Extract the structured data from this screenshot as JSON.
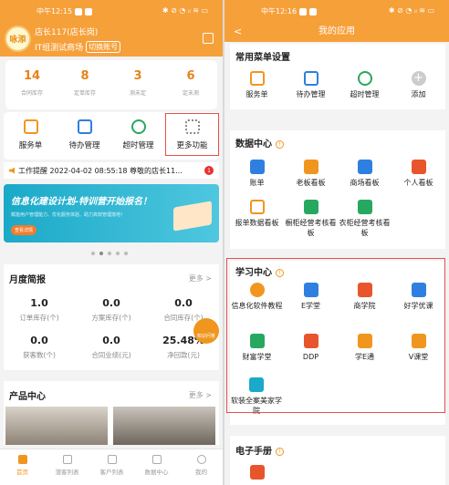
{
  "colors": {
    "accent": "#f6a03a",
    "highlight": "#e35050"
  },
  "left": {
    "status_time": "中午12:15",
    "status_right": "✱ ⊘ ◔ ᵢₗ ≋ ▭",
    "logo_text": "咏添",
    "user_name": "店长117(店长岗)",
    "store_name": "IT组测试商场",
    "switch_label": "切换账号",
    "stats": [
      {
        "value": "14",
        "label": "合同库存"
      },
      {
        "value": "8",
        "label": "定单库存"
      },
      {
        "value": "3",
        "label": "测未定"
      },
      {
        "value": "6",
        "label": "定未测"
      }
    ],
    "quick": [
      {
        "label": "服务单",
        "icon": "clipboard-icon"
      },
      {
        "label": "待办管理",
        "icon": "todo-icon"
      },
      {
        "label": "超时管理",
        "icon": "alarm-clock-icon"
      },
      {
        "label": "更多功能",
        "icon": "more-grid-icon"
      }
    ],
    "notice": "工作提醒 2022-04-02 08:55:18 尊敬的店长11...",
    "notice_badge": "1",
    "banner_title": "信息化建设计划-特训营开始报名！",
    "banner_sub": "赋能用户管理能力、优化服务体验、助力高效管理落地！",
    "banner_btn": "查看详情",
    "monthly_title": "月度简报",
    "more": "更多 >",
    "monthly": [
      {
        "value": "1.0",
        "label": "订单库存(个)"
      },
      {
        "value": "0.0",
        "label": "方案库存(个)"
      },
      {
        "value": "0.0",
        "label": "合同库存(个)"
      },
      {
        "value": "0.0",
        "label": "获客数(个)"
      },
      {
        "value": "0.0",
        "label": "合同业绩(元)"
      },
      {
        "value": "25.48%",
        "label": "净回款(元)"
      }
    ],
    "fab_label": "知识问答",
    "product_title": "产品中心",
    "product_more": "更多 >",
    "tabs": [
      {
        "label": "首页",
        "icon": "home-icon"
      },
      {
        "label": "潜客列表",
        "icon": "list-icon"
      },
      {
        "label": "客户列表",
        "icon": "customers-icon"
      },
      {
        "label": "数据中心",
        "icon": "chart-icon"
      },
      {
        "label": "我的",
        "icon": "profile-icon"
      }
    ]
  },
  "right": {
    "status_time": "中午12:16",
    "status_right": "✱ ⊘ ◔ ᵢₗ ≋ ▭",
    "title": "我的应用",
    "back": "<",
    "common_title": "常用菜单设置",
    "common": [
      {
        "label": "服务单",
        "icon": "clipboard-icon"
      },
      {
        "label": "待办管理",
        "icon": "todo-icon"
      },
      {
        "label": "超时管理",
        "icon": "alarm-clock-icon"
      },
      {
        "label": "添加",
        "icon": "add-icon"
      }
    ],
    "data_title": "数据中心",
    "data_items": [
      {
        "label": "账单",
        "icon": "bill-icon"
      },
      {
        "label": "老板看板",
        "icon": "boss-board-icon"
      },
      {
        "label": "商场看板",
        "icon": "mall-board-icon"
      },
      {
        "label": "个人看板",
        "icon": "personal-board-icon"
      },
      {
        "label": "报单数据看板",
        "icon": "report-board-icon"
      },
      {
        "label": "橱柜经营考核看板",
        "icon": "cabinet-board-icon"
      },
      {
        "label": "衣柜经营考核看板",
        "icon": "wardrobe-board-icon"
      }
    ],
    "learn_title": "学习中心",
    "learn_items": [
      {
        "label": "信息化软件教程",
        "icon": "software-tutorial-icon"
      },
      {
        "label": "E学堂",
        "icon": "e-school-icon"
      },
      {
        "label": "商学院",
        "icon": "business-school-icon"
      },
      {
        "label": "好学优课",
        "icon": "book-icon"
      },
      {
        "label": "财富学堂",
        "icon": "wealth-school-icon"
      },
      {
        "label": "DDP",
        "icon": "ddp-icon"
      },
      {
        "label": "学E通",
        "icon": "graduation-icon"
      },
      {
        "label": "V课堂",
        "icon": "v-class-icon"
      },
      {
        "label": "软装全案美家学院",
        "icon": "home-decor-icon"
      }
    ],
    "ebook_title": "电子手册"
  }
}
